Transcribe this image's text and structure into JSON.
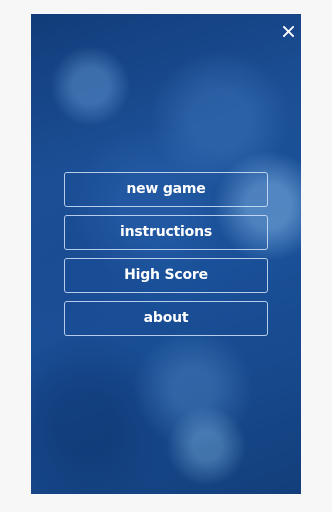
{
  "menu": {
    "items": [
      {
        "label": "new game"
      },
      {
        "label": "instructions"
      },
      {
        "label": "High Score"
      },
      {
        "label": "about"
      }
    ]
  },
  "close": {
    "icon": "close-icon",
    "color": "#ffffff"
  },
  "colors": {
    "background": "#1a4f94",
    "button_border": "#d2e4fa",
    "button_text": "#ffffff"
  }
}
